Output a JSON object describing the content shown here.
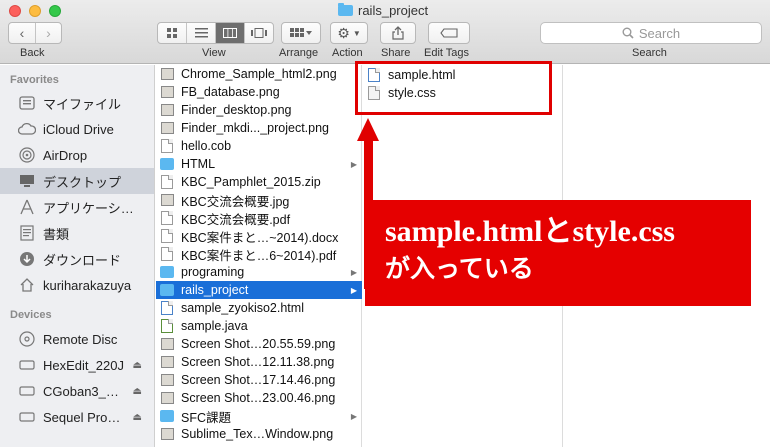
{
  "window": {
    "title": "rails_project"
  },
  "toolbar": {
    "back_label": "Back",
    "view_label": "View",
    "arrange_label": "Arrange",
    "action_label": "Action",
    "share_label": "Share",
    "edit_tags_label": "Edit Tags",
    "search_label": "Search",
    "search_placeholder": "Search"
  },
  "sidebar": {
    "favorites_header": "Favorites",
    "favorites": [
      {
        "label": "マイファイル",
        "icon": "my-files-icon"
      },
      {
        "label": "iCloud Drive",
        "icon": "cloud-icon"
      },
      {
        "label": "AirDrop",
        "icon": "airdrop-icon"
      },
      {
        "label": "デスクトップ",
        "icon": "desktop-icon",
        "selected": true
      },
      {
        "label": "アプリケーシ…",
        "icon": "applications-icon"
      },
      {
        "label": "書類",
        "icon": "documents-icon"
      },
      {
        "label": "ダウンロード",
        "icon": "downloads-icon"
      },
      {
        "label": "kuriharakazuya",
        "icon": "home-icon"
      }
    ],
    "devices_header": "Devices",
    "devices": [
      {
        "label": "Remote Disc",
        "icon": "disc-icon"
      },
      {
        "label": "HexEdit_220J",
        "icon": "drive-icon",
        "eject": true
      },
      {
        "label": "CGoban3_…",
        "icon": "drive-icon",
        "eject": true
      },
      {
        "label": "Sequel Pro…",
        "icon": "drive-icon",
        "eject": true
      }
    ]
  },
  "column1": [
    {
      "name": "Chrome_Sample_html2.png",
      "kind": "image"
    },
    {
      "name": "FB_database.png",
      "kind": "image"
    },
    {
      "name": "Finder_desktop.png",
      "kind": "image"
    },
    {
      "name": "Finder_mkdi..._project.png",
      "kind": "image"
    },
    {
      "name": "hello.cob",
      "kind": "doc"
    },
    {
      "name": "HTML",
      "kind": "folder"
    },
    {
      "name": "KBC_Pamphlet_2015.zip",
      "kind": "zip"
    },
    {
      "name": "KBC交流会概要.jpg",
      "kind": "image"
    },
    {
      "name": "KBC交流会概要.pdf",
      "kind": "doc"
    },
    {
      "name": "KBC案件まと…~2014).docx",
      "kind": "doc"
    },
    {
      "name": "KBC案件まと…6~2014).pdf",
      "kind": "doc"
    },
    {
      "name": "programing",
      "kind": "folder"
    },
    {
      "name": "rails_project",
      "kind": "folder",
      "selected": true
    },
    {
      "name": "sample_zyokiso2.html",
      "kind": "html"
    },
    {
      "name": "sample.java",
      "kind": "java"
    },
    {
      "name": "Screen Shot…20.55.59.png",
      "kind": "image"
    },
    {
      "name": "Screen Shot…12.11.38.png",
      "kind": "image"
    },
    {
      "name": "Screen Shot…17.14.46.png",
      "kind": "image"
    },
    {
      "name": "Screen Shot…23.00.46.png",
      "kind": "image"
    },
    {
      "name": "SFC課題",
      "kind": "folder"
    },
    {
      "name": "Sublime_Tex…Window.png",
      "kind": "image"
    }
  ],
  "column2": [
    {
      "name": "sample.html",
      "kind": "html"
    },
    {
      "name": "style.css",
      "kind": "css"
    }
  ],
  "annotation": {
    "line1": "sample.htmlとstyle.css",
    "line2": "が入っている",
    "color": "#e50000"
  }
}
